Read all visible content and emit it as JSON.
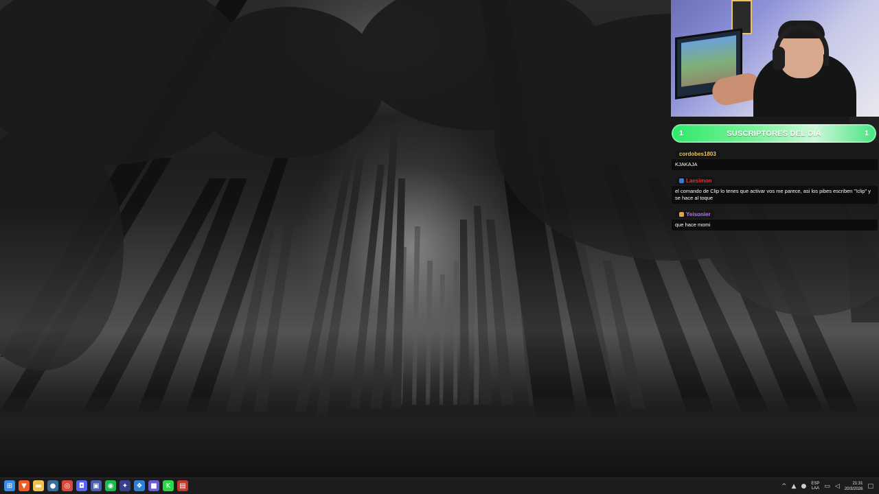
{
  "overlay": {
    "subs_banner": {
      "title": "SUSCRIPTORES DEL DIA",
      "left_count": "1",
      "right_count": "1"
    },
    "chat": [
      {
        "username": "cordobes1803",
        "name_color": "#f0c35a",
        "badge": "",
        "text": "KJAKAJA"
      },
      {
        "username": "Laesimon",
        "name_color": "#e0342c",
        "badge": "#3a7bd5",
        "text": "el comando de Clip lo tenes que activar vos me parece, asi los pibes escriben \"!clip\" y se hace al toque"
      },
      {
        "username": "Yeisonier",
        "name_color": "#b47ce8",
        "badge": "#e8a23c",
        "text": "que hace momi"
      }
    ]
  },
  "taskbar": {
    "apps": [
      {
        "name": "windows-start-icon",
        "glyph": "⊞",
        "color": "#3a8ee6"
      },
      {
        "name": "brave-browser-icon",
        "glyph": "▼",
        "color": "#f05a24"
      },
      {
        "name": "file-explorer-icon",
        "glyph": "▬",
        "color": "#f2c14e"
      },
      {
        "name": "steam-icon",
        "glyph": "●",
        "color": "#3b6d99"
      },
      {
        "name": "chrome-icon",
        "glyph": "◎",
        "color": "#d9483b"
      },
      {
        "name": "discord-icon",
        "glyph": "◘",
        "color": "#5865f2"
      },
      {
        "name": "app-window-icon",
        "glyph": "▣",
        "color": "#4a5fb3"
      },
      {
        "name": "spotify-icon",
        "glyph": "◉",
        "color": "#1db954"
      },
      {
        "name": "game-launcher-icon",
        "glyph": "✦",
        "color": "#3a3f8a"
      },
      {
        "name": "controller-icon",
        "glyph": "❖",
        "color": "#2e7fd6"
      },
      {
        "name": "obs-icon",
        "glyph": "■",
        "color": "#6d5bd0"
      },
      {
        "name": "kick-icon",
        "glyph": "K",
        "color": "#28d94a"
      },
      {
        "name": "streaming-app-icon",
        "glyph": "▤",
        "color": "#c0392b"
      }
    ],
    "language": "ESP",
    "keyboard_layout": "LAA",
    "time": "21:31",
    "date": "20/3/2026",
    "tray_glyphs": [
      "^",
      "▲",
      "●",
      "▭",
      "◁"
    ]
  }
}
